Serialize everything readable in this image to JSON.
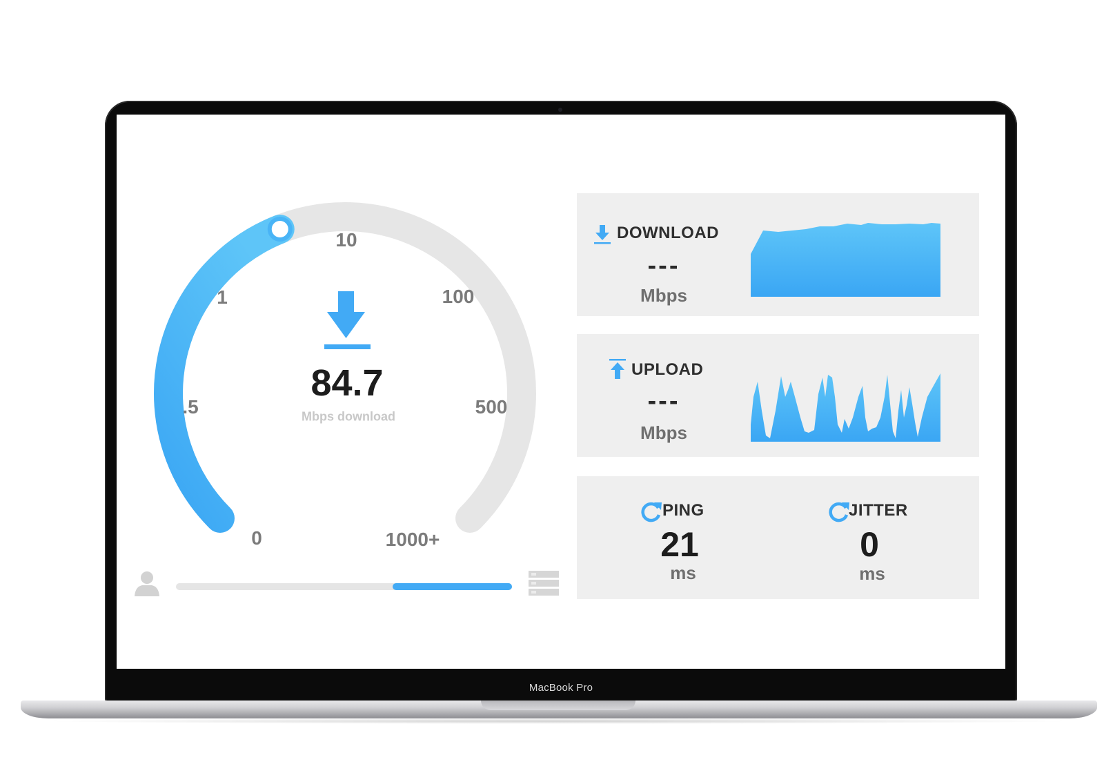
{
  "device": {
    "model_label": "MacBook Pro"
  },
  "colors": {
    "accent": "#42aaf5",
    "accent_light": "#5ec4f7",
    "track": "#e6e6e6",
    "card_bg": "#efefef"
  },
  "gauge": {
    "value": "84.7",
    "unit_label": "Mbps download",
    "icon": "download-arrow-icon",
    "scale_labels": [
      "0",
      ".5",
      "1",
      "10",
      "100",
      "500",
      "1000+"
    ],
    "fill_fraction": 0.42
  },
  "progress": {
    "client_icon": "user-icon",
    "server_icon": "server-icon",
    "fill_start_fraction": 0.645,
    "fill_end_fraction": 1.0
  },
  "download": {
    "title": "DOWNLOAD",
    "icon": "download-icon",
    "value": "---",
    "unit": "Mbps"
  },
  "upload": {
    "title": "UPLOAD",
    "icon": "upload-icon",
    "value": "---",
    "unit": "Mbps"
  },
  "ping": {
    "title": "PING",
    "icon": "refresh-icon",
    "value": "21",
    "unit": "ms"
  },
  "jitter": {
    "title": "JITTER",
    "icon": "refresh-icon",
    "value": "0",
    "unit": "ms"
  }
}
